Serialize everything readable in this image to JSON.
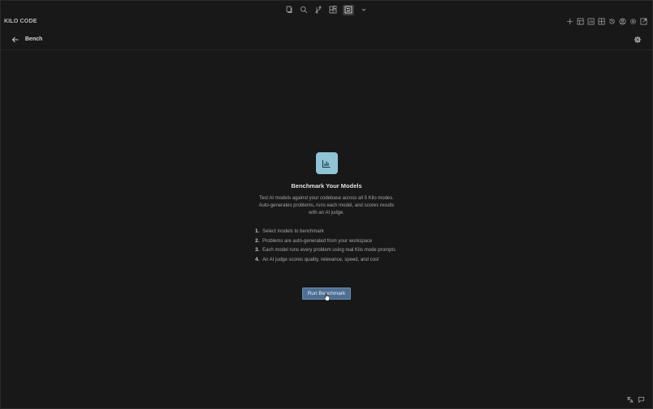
{
  "titlebar": {
    "icons": [
      "files-icon",
      "search-icon",
      "source-control-icon",
      "extensions-icon",
      "kilo-panel-icon",
      "chevron-down-icon"
    ]
  },
  "header": {
    "brand": "KILO CODE",
    "actions": [
      "plus-icon",
      "layout-icon",
      "chart-icon",
      "grid-icon",
      "history-icon",
      "account-icon",
      "settings-icon",
      "popout-icon"
    ]
  },
  "nav": {
    "title": "Bench"
  },
  "main": {
    "heading": "Benchmark Your Models",
    "description": "Test AI models against your codebase across all 5 Kilo modes. Auto-generates problems, runs each model, and scores results with an AI judge.",
    "steps": [
      {
        "num": "1.",
        "text": "Select models to benchmark"
      },
      {
        "num": "2.",
        "text": "Problems are auto-generated from your workspace"
      },
      {
        "num": "3.",
        "text": "Each model runs every problem using real Kilo mode prompts"
      },
      {
        "num": "4.",
        "text": "An AI judge scores quality, relevance, speed, and cost"
      }
    ],
    "run_button": "Run Benchmark"
  },
  "colors": {
    "accent_icon_bg": "#8fc3d6",
    "button_bg": "#4d6f93",
    "background": "#181818"
  }
}
